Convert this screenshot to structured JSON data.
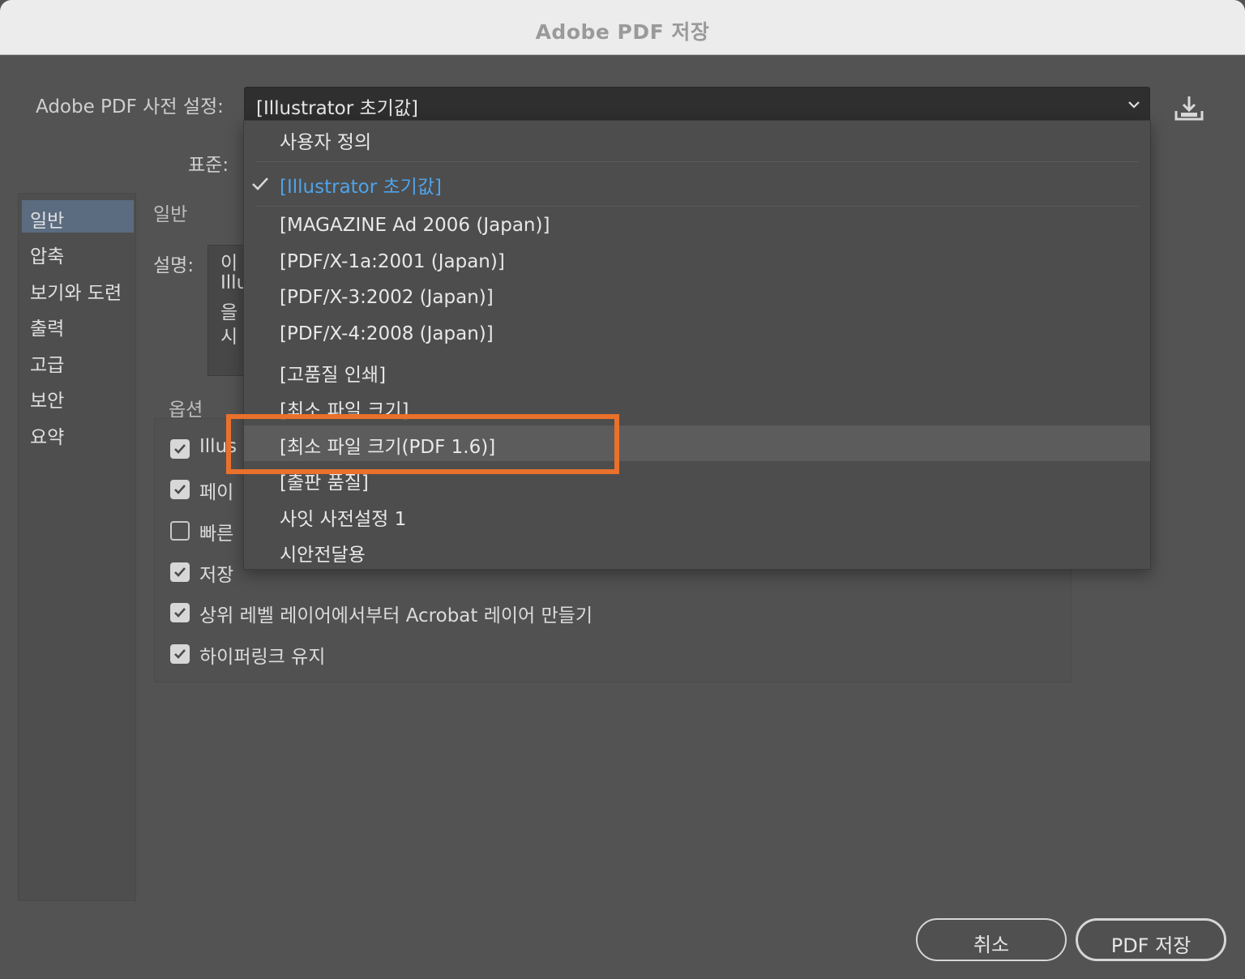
{
  "window": {
    "title": "Adobe PDF 저장"
  },
  "preset": {
    "label": "Adobe PDF 사전 설정:",
    "selected": "[Illustrator 초기값]",
    "chevron_icon": "chevron-down-icon",
    "save_icon": "save-preset-icon"
  },
  "standard": {
    "label": "표준:"
  },
  "sidebar": {
    "items": [
      {
        "label": "일반",
        "active": true
      },
      {
        "label": "압축"
      },
      {
        "label": "보기와 도련"
      },
      {
        "label": "출력"
      },
      {
        "label": "고급"
      },
      {
        "label": "보안"
      },
      {
        "label": "요약"
      }
    ]
  },
  "general": {
    "heading": "일반",
    "description_label": "설명:",
    "description_lines": [
      "이",
      "Illu",
      "을",
      "시"
    ],
    "options_heading": "옵션"
  },
  "options": [
    {
      "label": "Illus",
      "checked": true
    },
    {
      "label": "페이",
      "checked": true
    },
    {
      "label": "빠른",
      "checked": false
    },
    {
      "label": "저장",
      "checked": true
    },
    {
      "label": "상위 레벨 레이어에서부터 Acrobat 레이어 만들기",
      "checked": true
    },
    {
      "label": "하이퍼링크 유지",
      "checked": true
    }
  ],
  "dropdown": {
    "items": [
      {
        "label": "사용자 정의"
      },
      {
        "label": "[Illustrator 초기값]",
        "checked": true
      },
      {
        "label": "[MAGAZINE Ad 2006 (Japan)]"
      },
      {
        "label": "[PDF/X-1a:2001 (Japan)]"
      },
      {
        "label": "[PDF/X-3:2002 (Japan)]"
      },
      {
        "label": "[PDF/X-4:2008 (Japan)]"
      },
      {
        "label": "[고품질 인쇄]"
      },
      {
        "label": "[최소 파일 크기]"
      },
      {
        "label": "[최소 파일 크기(PDF 1.6)]",
        "hover": true,
        "highlighted": true
      },
      {
        "label": "[출판 품질]"
      },
      {
        "label": "사잇 사전설정 1"
      },
      {
        "label": "시안전달용"
      }
    ],
    "highlight_color": "#e9712b",
    "checked_color": "#4fa3e8"
  },
  "buttons": {
    "cancel": "취소",
    "save": "PDF 저장"
  }
}
